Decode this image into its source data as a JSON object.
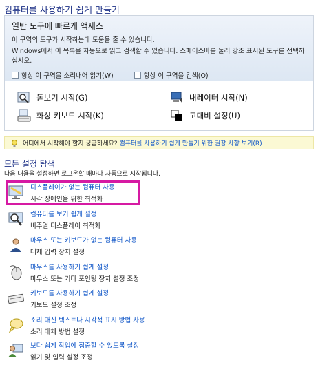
{
  "page": {
    "title": "컴퓨터를 사용하기 쉽게 만들기"
  },
  "quick_access": {
    "title": "일반 도구에 빠르게 액세스",
    "line1": "이 구역의 도구가 시작하는데 도움을 줄 수 있습니다.",
    "line2": "Windows에서 이 목록을 자동으로 읽고 검색할 수 있습니다. 스페이스바를 눌러 강조 표시된 도구를 선택하십시오.",
    "check_read": "항상 이 구역을 소리내어 읽기(W)",
    "check_scan": "항상 이 구역을 검색(O)"
  },
  "tools": {
    "magnifier": "돋보기 시작(G)",
    "narrator": "내레이터 시작(N)",
    "keyboard": "화상 키보드 시작(K)",
    "contrast": "고대비 설정(U)"
  },
  "tip": {
    "text": "어디에서 시작해야 할지 궁금하세요?",
    "link": "컴퓨터를 사용하기 쉽게 만들기 위한 권장 사항 보기(R)"
  },
  "settings": {
    "title": "모든 설정 탐색",
    "intro": "다음 내용을 설정하면 로그온할 때마다 자동으로 시작됩니다.",
    "items": [
      {
        "link": "디스플레이가 없는 컴퓨터 사용",
        "desc": "시각 장애인을 위한 최적화",
        "icon": "display-icon"
      },
      {
        "link": "컴퓨터를 보기 쉽게 설정",
        "desc": "비주얼 디스플레이 최적화",
        "icon": "magnifier-icon"
      },
      {
        "link": "마우스 또는 키보드가 없는 컴퓨터 사용",
        "desc": "대체 입력 장치 설정",
        "icon": "person-icon"
      },
      {
        "link": "마우스를 사용하기 쉽게 설정",
        "desc": "마우스 또는 기타 포인팅 장치 설정 조정",
        "icon": "mouse-icon"
      },
      {
        "link": "키보드를 사용하기 쉽게 설정",
        "desc": "키보드 설정 조정",
        "icon": "keyboard-icon"
      },
      {
        "link": "소리 대신 텍스트나 시각적 표시 방법 사용",
        "desc": "소리 대체 방법 설정",
        "icon": "speech-bubble-icon"
      },
      {
        "link": "보다 쉽게 작업에 집중할 수 있도록 설정",
        "desc": "읽기 및 입력 설정 조정",
        "icon": "focus-icon"
      }
    ]
  },
  "colors": {
    "heading": "#1e3287",
    "link": "#0d54c7",
    "highlight": "#d61aa3",
    "tip_bg": "#fbf9d4"
  }
}
